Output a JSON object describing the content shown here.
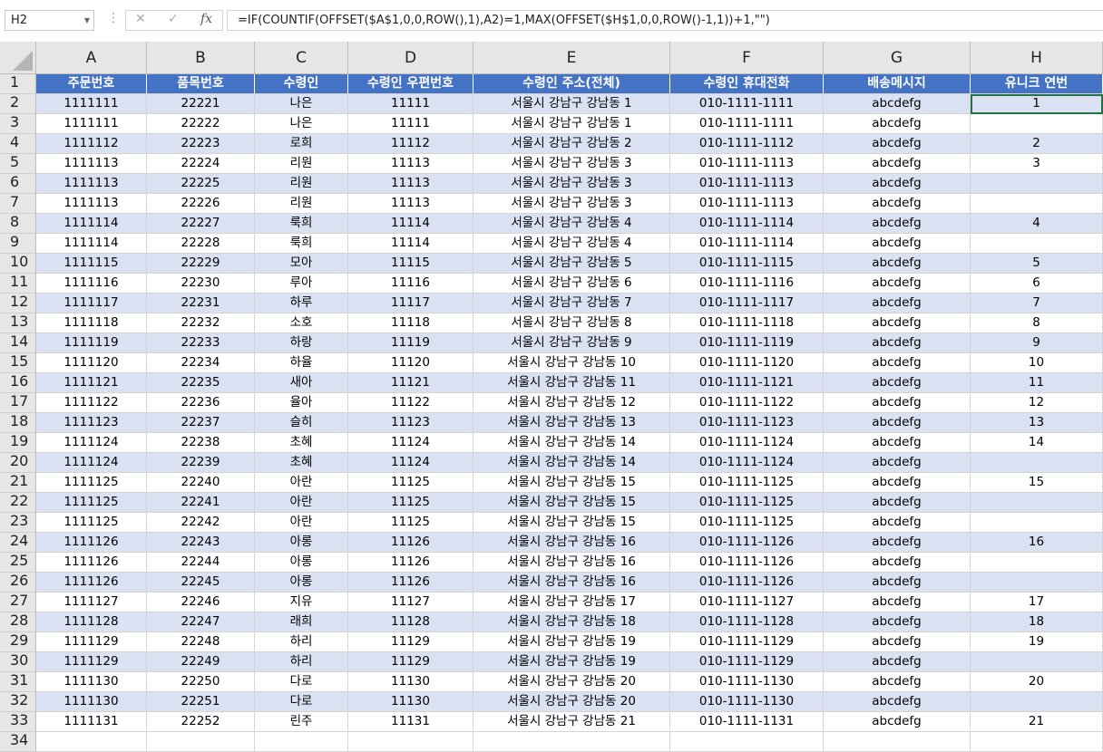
{
  "formula_bar": {
    "name_box": "H2",
    "cancel_icon": "✕",
    "enter_icon": "✓",
    "fx_label": "fx",
    "formula": "=IF(COUNTIF(OFFSET($A$1,0,0,ROW(),1),A2)=1,MAX(OFFSET($H$1,0,0,ROW()-1,1))+1,\"\")"
  },
  "columns": [
    "A",
    "B",
    "C",
    "D",
    "E",
    "F",
    "G",
    "H"
  ],
  "headers": [
    "주문번호",
    "품목번호",
    "수령인",
    "수령인 우편번호",
    "수령인 주소(전체)",
    "수령인 휴대전화",
    "배송메시지",
    "유니크 연번"
  ],
  "row_numbers": [
    "1",
    "2",
    "3",
    "4",
    "5",
    "6",
    "7",
    "8",
    "9",
    "10",
    "11",
    "12",
    "13",
    "14",
    "15",
    "16",
    "17",
    "18",
    "19",
    "20",
    "21",
    "22",
    "23",
    "24",
    "25",
    "26",
    "27",
    "28",
    "29",
    "30",
    "31",
    "32",
    "33",
    "34"
  ],
  "rows": [
    [
      "1111111",
      "22221",
      "나은",
      "11111",
      "서울시 강남구 강남동 1",
      "010-1111-1111",
      "abcdefg",
      "1"
    ],
    [
      "1111111",
      "22222",
      "나은",
      "11111",
      "서울시 강남구 강남동 1",
      "010-1111-1111",
      "abcdefg",
      ""
    ],
    [
      "1111112",
      "22223",
      "로희",
      "11112",
      "서울시 강남구 강남동 2",
      "010-1111-1112",
      "abcdefg",
      "2"
    ],
    [
      "1111113",
      "22224",
      "리원",
      "11113",
      "서울시 강남구 강남동 3",
      "010-1111-1113",
      "abcdefg",
      "3"
    ],
    [
      "1111113",
      "22225",
      "리원",
      "11113",
      "서울시 강남구 강남동 3",
      "010-1111-1113",
      "abcdefg",
      ""
    ],
    [
      "1111113",
      "22226",
      "리원",
      "11113",
      "서울시 강남구 강남동 3",
      "010-1111-1113",
      "abcdefg",
      ""
    ],
    [
      "1111114",
      "22227",
      "룩희",
      "11114",
      "서울시 강남구 강남동 4",
      "010-1111-1114",
      "abcdefg",
      "4"
    ],
    [
      "1111114",
      "22228",
      "룩희",
      "11114",
      "서울시 강남구 강남동 4",
      "010-1111-1114",
      "abcdefg",
      ""
    ],
    [
      "1111115",
      "22229",
      "모아",
      "11115",
      "서울시 강남구 강남동 5",
      "010-1111-1115",
      "abcdefg",
      "5"
    ],
    [
      "1111116",
      "22230",
      "루아",
      "11116",
      "서울시 강남구 강남동 6",
      "010-1111-1116",
      "abcdefg",
      "6"
    ],
    [
      "1111117",
      "22231",
      "하루",
      "11117",
      "서울시 강남구 강남동 7",
      "010-1111-1117",
      "abcdefg",
      "7"
    ],
    [
      "1111118",
      "22232",
      "소호",
      "11118",
      "서울시 강남구 강남동 8",
      "010-1111-1118",
      "abcdefg",
      "8"
    ],
    [
      "1111119",
      "22233",
      "하랑",
      "11119",
      "서울시 강남구 강남동 9",
      "010-1111-1119",
      "abcdefg",
      "9"
    ],
    [
      "1111120",
      "22234",
      "하율",
      "11120",
      "서울시 강남구 강남동 10",
      "010-1111-1120",
      "abcdefg",
      "10"
    ],
    [
      "1111121",
      "22235",
      "새아",
      "11121",
      "서울시 강남구 강남동 11",
      "010-1111-1121",
      "abcdefg",
      "11"
    ],
    [
      "1111122",
      "22236",
      "율아",
      "11122",
      "서울시 강남구 강남동 12",
      "010-1111-1122",
      "abcdefg",
      "12"
    ],
    [
      "1111123",
      "22237",
      "슬히",
      "11123",
      "서울시 강남구 강남동 13",
      "010-1111-1123",
      "abcdefg",
      "13"
    ],
    [
      "1111124",
      "22238",
      "초혜",
      "11124",
      "서울시 강남구 강남동 14",
      "010-1111-1124",
      "abcdefg",
      "14"
    ],
    [
      "1111124",
      "22239",
      "초혜",
      "11124",
      "서울시 강남구 강남동 14",
      "010-1111-1124",
      "abcdefg",
      ""
    ],
    [
      "1111125",
      "22240",
      "아란",
      "11125",
      "서울시 강남구 강남동 15",
      "010-1111-1125",
      "abcdefg",
      "15"
    ],
    [
      "1111125",
      "22241",
      "아란",
      "11125",
      "서울시 강남구 강남동 15",
      "010-1111-1125",
      "abcdefg",
      ""
    ],
    [
      "1111125",
      "22242",
      "아란",
      "11125",
      "서울시 강남구 강남동 15",
      "010-1111-1125",
      "abcdefg",
      ""
    ],
    [
      "1111126",
      "22243",
      "아롱",
      "11126",
      "서울시 강남구 강남동 16",
      "010-1111-1126",
      "abcdefg",
      "16"
    ],
    [
      "1111126",
      "22244",
      "아롱",
      "11126",
      "서울시 강남구 강남동 16",
      "010-1111-1126",
      "abcdefg",
      ""
    ],
    [
      "1111126",
      "22245",
      "아롱",
      "11126",
      "서울시 강남구 강남동 16",
      "010-1111-1126",
      "abcdefg",
      ""
    ],
    [
      "1111127",
      "22246",
      "지유",
      "11127",
      "서울시 강남구 강남동 17",
      "010-1111-1127",
      "abcdefg",
      "17"
    ],
    [
      "1111128",
      "22247",
      "래희",
      "11128",
      "서울시 강남구 강남동 18",
      "010-1111-1128",
      "abcdefg",
      "18"
    ],
    [
      "1111129",
      "22248",
      "하리",
      "11129",
      "서울시 강남구 강남동 19",
      "010-1111-1129",
      "abcdefg",
      "19"
    ],
    [
      "1111129",
      "22249",
      "하리",
      "11129",
      "서울시 강남구 강남동 19",
      "010-1111-1129",
      "abcdefg",
      ""
    ],
    [
      "1111130",
      "22250",
      "다로",
      "11130",
      "서울시 강남구 강남동 20",
      "010-1111-1130",
      "abcdefg",
      "20"
    ],
    [
      "1111130",
      "22251",
      "다로",
      "11130",
      "서울시 강남구 강남동 20",
      "010-1111-1130",
      "abcdefg",
      ""
    ],
    [
      "1111131",
      "22252",
      "린주",
      "11131",
      "서울시 강남구 강남동 21",
      "010-1111-1131",
      "abcdefg",
      "21"
    ]
  ],
  "colors": {
    "header_fill": "#4472c4",
    "band_fill": "#d9e1f2",
    "selection": "#217346"
  },
  "icons": {
    "name_box_dropdown": "chevron-down-icon",
    "cancel": "close-icon",
    "enter": "check-icon",
    "function": "fx-icon"
  }
}
